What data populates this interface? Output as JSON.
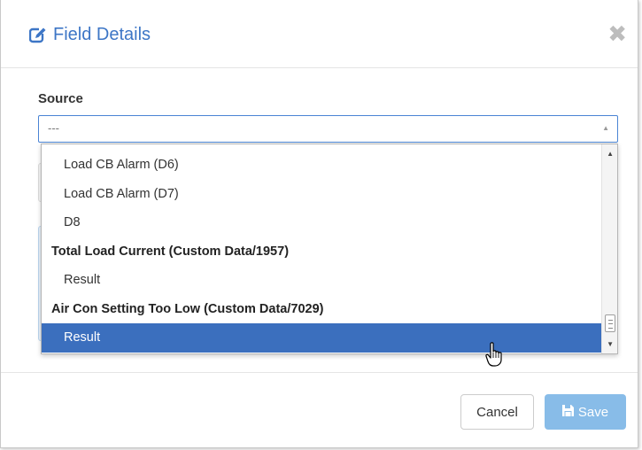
{
  "dialog": {
    "title": "Field Details",
    "title_icon": "edit-icon",
    "close_icon": "close-icon"
  },
  "form": {
    "source_label": "Source",
    "source_value": "---"
  },
  "dropdown": {
    "items": [
      {
        "type": "option",
        "label": "Load CB Alarm (D6)"
      },
      {
        "type": "option",
        "label": "Load CB Alarm (D7)"
      },
      {
        "type": "option",
        "label": "D8"
      },
      {
        "type": "group",
        "label": "Total Load Current (Custom Data/1957)"
      },
      {
        "type": "option",
        "label": "Result"
      },
      {
        "type": "group",
        "label": "Air Con Setting Too Low (Custom Data/7029)"
      },
      {
        "type": "option",
        "label": "Result",
        "selected": true
      }
    ]
  },
  "footer": {
    "cancel_label": "Cancel",
    "save_label": "Save",
    "save_icon": "floppy-disk-icon"
  },
  "colors": {
    "accent": "#3d76c6",
    "selected_row": "#3b6fbe",
    "save_button": "#88bce8"
  }
}
